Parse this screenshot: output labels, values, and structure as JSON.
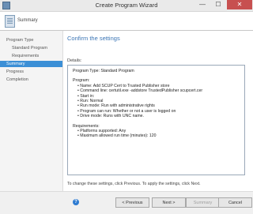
{
  "window": {
    "title": "Create Program Wizard",
    "close_symbol": "✕",
    "min_symbol": "—",
    "max_symbol": "☐"
  },
  "header": {
    "title": "Summary",
    "icon": "document-icon"
  },
  "sidebar": {
    "items": [
      {
        "label": "Program Type"
      },
      {
        "label": "Standard Program"
      },
      {
        "label": "Requirements"
      },
      {
        "label": "Summary"
      },
      {
        "label": "Progress"
      },
      {
        "label": "Completion"
      }
    ]
  },
  "main": {
    "title": "Confirm the settings",
    "details_label": "Details:",
    "details": {
      "line1": "Program Type: Standard Program",
      "section_program": "Program:",
      "program_items": [
        "Name: Add SCUP Cert to Trusted Publisher store",
        "Command line: certutil.exe -addstore TrustedPublisher scupcert.cer",
        "Start in:",
        "Run: Normal",
        "Run mode: Run with administrative rights",
        "Program can run: Whether or not a user is logged on",
        "Drive mode: Runs with UNC name."
      ],
      "section_requirements": "Requirements:",
      "requirements_items": [
        "Platforms supported: Any",
        "Maximum allowed run time (minutes): 120"
      ]
    },
    "instructions": "To change these settings, click Previous. To apply the settings, click Next."
  },
  "footer": {
    "help_symbol": "?",
    "previous": "< Previous",
    "next": "Next >",
    "summary": "Summary",
    "cancel": "Cancel"
  }
}
